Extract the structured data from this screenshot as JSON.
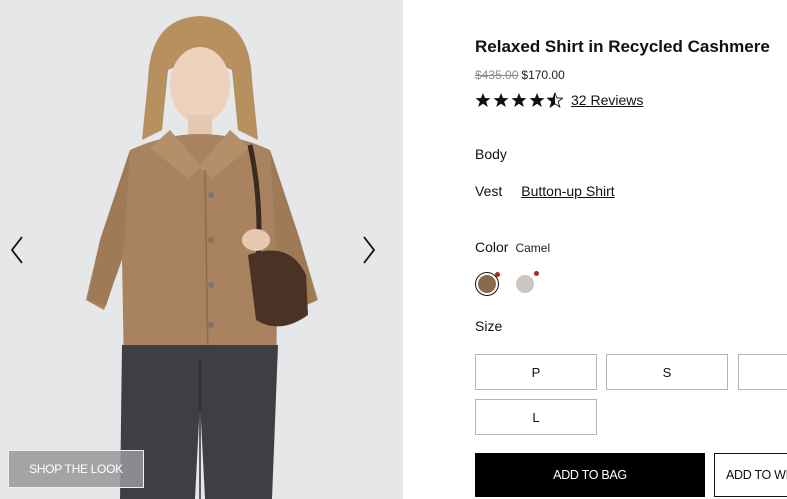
{
  "gallery": {
    "prev_icon": "chevron-left-icon",
    "next_icon": "chevron-right-icon",
    "shop_the_look": "SHOP THE LOOK"
  },
  "product": {
    "title": "Relaxed Shirt in Recycled Cashmere",
    "price_original": "$435.00",
    "price_sale": "$170.00",
    "rating": 4.5,
    "rating_max": 5,
    "reviews_link": "32 Reviews"
  },
  "body": {
    "label": "Body",
    "options": [
      "Vest",
      "Button-up Shirt"
    ],
    "selected": "Button-up Shirt"
  },
  "color": {
    "label": "Color",
    "selected_name": "Camel",
    "swatches": [
      {
        "name": "camel",
        "hex": "#8a6a4a",
        "selected": true
      },
      {
        "name": "light-grey",
        "hex": "#cdc7c2",
        "selected": false
      }
    ],
    "indicator_color": "#b0281e"
  },
  "size": {
    "label": "Size",
    "options": [
      "P",
      "S",
      "",
      "L"
    ]
  },
  "actions": {
    "add_to_bag": "ADD TO BAG",
    "add_to_wishlist": "ADD TO WIS"
  }
}
